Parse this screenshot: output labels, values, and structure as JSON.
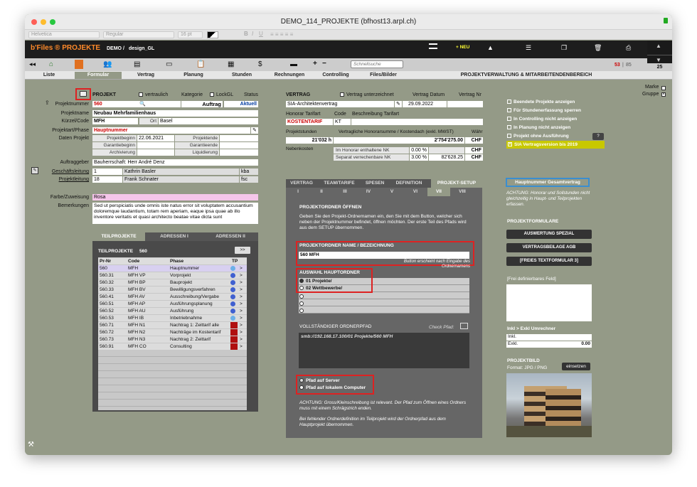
{
  "window": {
    "title": "DEMO_114_PROJEKTE (bfhost13.arpl.ch)"
  },
  "format_bar": {
    "font": "Helvetica",
    "style": "Regular",
    "size": "16 pt"
  },
  "header": {
    "app_title": "b'Files ® PROJEKTE",
    "db": "DEMO",
    "sep": "/",
    "user": "design_GL",
    "neu": "+ NEU",
    "search_placeholder": "Schnellsuche",
    "count_current": "53",
    "count_sep": "|",
    "count_found": "85",
    "count_total": "25"
  },
  "tabs": [
    "Liste",
    "Formular",
    "Vertrag",
    "Planung",
    "Stunden",
    "Rechnungen",
    "Controlling",
    "Files/Bilder"
  ],
  "section_title": "PROJEKTVERWALTUNG & MITARBEITENDENBEREICH",
  "marke": "Marke",
  "gruppe": "Gruppe",
  "projekt": {
    "header": "PROJEKT",
    "vertraulich": "vertraulich",
    "kategorie": "Kategorie",
    "lockgl": "LockGL",
    "status_label": "Status",
    "nr_label": "Projektnummer",
    "nr": "560",
    "type": "Auftrag",
    "status": "Aktuell",
    "name_label": "Projektname",
    "name": "Neubau Mehrfamilienhaus",
    "kurzel_label": "Kürzel/Code",
    "kurzel": "MFH",
    "ort_label": "Ort",
    "ort": "Basel",
    "art_label": "Projektart/Phase",
    "art": "Hauptnummer",
    "daten_label": "Daten Projekt",
    "beginn_label": "Projektbeginn",
    "beginn": "22.06.2021",
    "ende_label": "Projektende",
    "garbeg_label": "Garantiebeginn",
    "garend_label": "Garantieende",
    "archiv_label": "Archivierung",
    "liq_label": "Liquidierung",
    "auftrag_label": "Auftraggeber",
    "auftrag": "Bauherrschaft: Herr André Denz",
    "gl_label": "Geschäftsleitung",
    "gl_nr": "1",
    "gl_name": "Kathrin Basler",
    "gl_code": "kba",
    "pl_label": "Projektleitung",
    "pl_nr": "18",
    "pl_name": "Frank Schnater",
    "pl_code": "fsc",
    "farbe_label": "Farbe/Zuweisung",
    "farbe": "Rosa",
    "bem_label": "Bemerkungen",
    "bem": "Sed ut perspiciatis unde omnis iste natus error sit voluptatem accusantium doloremque laudantium, totam rem aperiam, eaque ipsa quae ab illo inventore veritatis et quasi architecto beatae vitae dicta sunt"
  },
  "teil": {
    "tabs": [
      "TEILPROJEKTE",
      "ADRESSEN I",
      "ADRESSEN II"
    ],
    "title": "TEILPROJEKTE",
    "title_nr": "560",
    "more": ">>",
    "cols": [
      "Pr-Nr",
      "Code",
      "Phase",
      "TP"
    ],
    "rows": [
      [
        "560",
        "MFH",
        "Hauptnummer"
      ],
      [
        "560.31",
        "MFH VP",
        "Vorprojekt"
      ],
      [
        "560.32",
        "MFH BP",
        "Bauprojekt"
      ],
      [
        "560.33",
        "MFH BV",
        "Bewilligungsverfahren"
      ],
      [
        "560.41",
        "MFH AV",
        "Ausschreibung/Vergabe"
      ],
      [
        "560.51",
        "MFH AP",
        "Ausführungsplanung"
      ],
      [
        "560.52",
        "MFH AU",
        "Ausführung"
      ],
      [
        "560.53",
        "MFH IB",
        "Inbetriebnahme"
      ],
      [
        "560.71",
        "MFH N1",
        "Nachtrag 1: Zeittarif alle"
      ],
      [
        "560.72",
        "MFH N2",
        "Nachträge im Kostentarif"
      ],
      [
        "560.73",
        "MFH N3",
        "Nachtrag 2: Zeittarif"
      ],
      [
        "560.91",
        "MFH CO",
        "Consulting"
      ]
    ],
    "arrow": ">"
  },
  "vertrag": {
    "header": "VERTRAG",
    "unterz": "Vertrag unterzeichnet",
    "datum_label": "Vertrag Datum",
    "nr_label": "Vertrag Nr",
    "name": "SIA-Architektenvertrag",
    "datum": "29.09.2022",
    "hon_label": "Honorar Tarifart",
    "code_label": "Code",
    "beschr_label": "Beschreibung Tarifart",
    "tarif": "KOSTENTARIF",
    "code": "KT",
    "stunden_label": "Projektstunden",
    "summe_label": "Vertragliche Honorarsumme / Kostendach (exkl. MWST)",
    "waehr_label": "Währ",
    "stunden": "21'032 h",
    "summe": "2'754'275.00",
    "waehr": "CHF",
    "nk_label": "Nebenkosten",
    "nk1_label": "Im Honorar enthaltene NK",
    "nk1": "0.00 %",
    "nk1w": "CHF",
    "nk2_label": "Separat verrechenbare NK",
    "nk2": "3.00 %",
    "nk2v": "82'628.25",
    "nk2w": "CHF"
  },
  "setup": {
    "tabs": [
      "VERTRAG",
      "TEAM/TARIFE",
      "SPESEN",
      "DEFINITION",
      "PROJEKT-SETUP"
    ],
    "roman": [
      "I",
      "II",
      "III",
      "IV",
      "V",
      "VI",
      "VII",
      "VIII"
    ],
    "title": "PROJEKTORDNER ÖFFNEN",
    "text": "Geben Sie den Projekt-Ordnernamen ein, den Sie mit dem Button, welcher sich neben der Projektnummer befindet, öffnen möchten. Der erste Teil des Pfads wird aus dem SETUP übernommen.",
    "name_label": "PROJEKTORDNER NAME / BEZEICHNUNG",
    "name": "560 MFH",
    "hint": "Button erscheint nach Eingabe des Ordnernamens",
    "auswahl_label": "AUSWAHL HAUPTORDNER",
    "opt1": "01 Projekte/",
    "opt2": "02 Wettbewerbe/",
    "pfad_label": "VOLLSTÄNDIGER ORDNERPFAD",
    "check": "Check Pfad:",
    "pfad": "smb://192.168.17.100/01 Projekte/560 MFH",
    "server": "Pfad auf Server",
    "lokal": "Pfad auf lokalem Computer",
    "warn1": "ACHTUNG: Gross/Kleinschreibung ist relevant. Der Pfad zum Öffnen eines Ordners muss mit einem Schrägstrich enden.",
    "warn2": "Bei fehlender Ordnerdefinition im Teilprojekt wird der Ordnerpfad aus dem Hauptprojekt übernommen."
  },
  "right": {
    "checks": [
      "Beendete Projekte anzeigen",
      "Für Stundenerfassung sperren",
      "In Controlling nicht anzeigen",
      "In Planung nicht anzeigen",
      "Projekt ohne Ausführung"
    ],
    "q": "?",
    "sia": "SIA Vertragsversion bis 2019",
    "haupt_btn": "Hauptnummer Gesamtvertrag",
    "haupt_note": "ACHTUNG: Honorar und Sollstunden nicht gleichzeitig in Haupt- und Teilprojekten erfassen.",
    "formulare": "PROJEKTFORMULARE",
    "f1": "AUSWERTUNG SPEZIAL",
    "f2": "VERTRAGSBEILAGE AGB",
    "f3": "[FREIES TEXTFORMULAR 3]",
    "frei": "[Frei definierbares Feld]",
    "umr": "Inkl > Exkl Umrechner",
    "inkl": "Inkl.",
    "exkl": "Exkl.",
    "exkl_val": "0.00",
    "bild": "PROJEKTBILD",
    "format": "Format: JPG / PNG",
    "einsetzen": "einsetzen"
  },
  "colors": {
    "accent_red": "#c00000",
    "highlight_yellow": "#c8c800",
    "pink": "#f5c6ea"
  }
}
